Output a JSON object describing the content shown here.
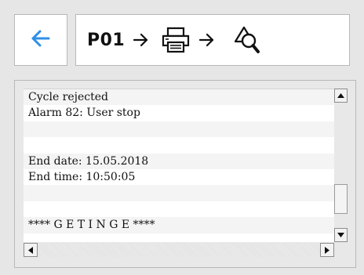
{
  "toolbar": {
    "back_icon": "arrow-left-icon",
    "program_label": "P01",
    "steps": [
      "arrow-right-icon",
      "printer-icon",
      "arrow-right-icon",
      "search-alarm-icon"
    ],
    "accent_color": "#2f8fe6"
  },
  "log": {
    "lines": [
      "Cycle rejected",
      "Alarm 82: User stop",
      "",
      "",
      "End date: 15.05.2018",
      "End time: 10:50:05",
      "",
      "",
      "**** G E T I N G E ****",
      ""
    ]
  },
  "scrollbars": {
    "vertical_position": 0.85,
    "horizontal_position": 0.0
  }
}
